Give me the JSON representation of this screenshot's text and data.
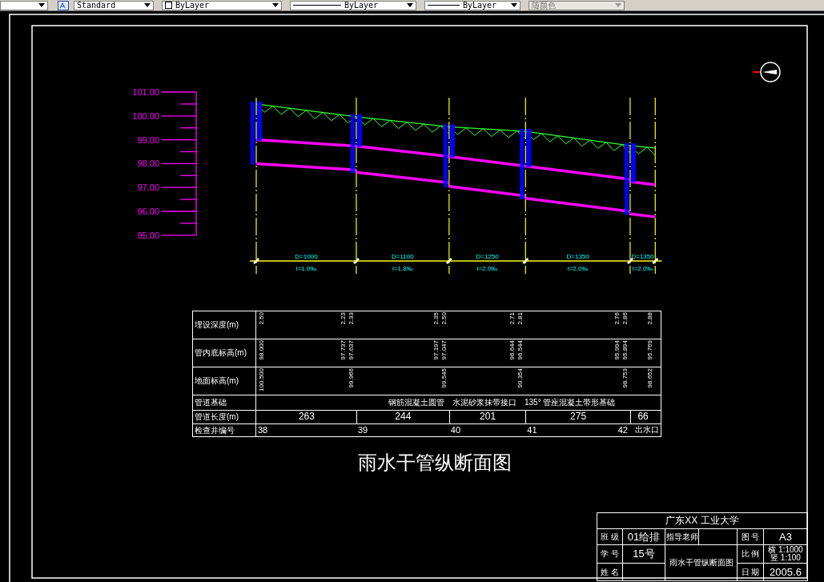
{
  "toolbar": {
    "dropdowns": [
      {
        "kind": "text-style",
        "value": "Standard",
        "disabled": false
      },
      {
        "kind": "layer-color",
        "value": "ByLayer",
        "disabled": false
      },
      {
        "kind": "linetype",
        "value": "ByLayer",
        "disabled": false
      },
      {
        "kind": "lineweight",
        "value": "ByLayer",
        "disabled": false
      },
      {
        "kind": "plot-style",
        "value": "随颜色",
        "disabled": true
      }
    ]
  },
  "profile": {
    "elevation_scale": [
      "101.00",
      "100.00",
      "99.00",
      "98.00",
      "97.00",
      "96.00",
      "95.00"
    ],
    "segments": [
      {
        "diameter": "D=1000",
        "slope": "i=1.0‰",
        "length": "263"
      },
      {
        "diameter": "D=1100",
        "slope": "i=1.8‰",
        "length": "244"
      },
      {
        "diameter": "D=1250",
        "slope": "i=2.0‰",
        "length": "201"
      },
      {
        "diameter": "D=1350",
        "slope": "i=2.0‰",
        "length": "275"
      },
      {
        "diameter": "D=1350",
        "slope": "i=2.0‰",
        "length": "66"
      }
    ],
    "stations": [
      {
        "kind": "manhole",
        "number": "38",
        "depth": [
          "2.50"
        ],
        "invert": [
          "98.000"
        ],
        "ground": "100.500"
      },
      {
        "kind": "manhole",
        "number": "39",
        "depth": [
          "2.23",
          "2.33"
        ],
        "invert": [
          "97.737",
          "97.637"
        ],
        "ground": "99.966"
      },
      {
        "kind": "manhole",
        "number": "40",
        "depth": [
          "2.35",
          "2.50"
        ],
        "invert": [
          "97.197",
          "97.047"
        ],
        "ground": "99.545"
      },
      {
        "kind": "manhole",
        "number": "41",
        "depth": [
          "2.71",
          "2.81"
        ],
        "invert": [
          "96.644",
          "96.544"
        ],
        "ground": "99.354"
      },
      {
        "kind": "manhole",
        "number": "42",
        "depth": [
          "2.76",
          "2.86"
        ],
        "invert": [
          "95.994",
          "95.894"
        ],
        "ground": "98.753"
      },
      {
        "kind": "outlet",
        "number": "出水口",
        "depth": [
          "2.88"
        ],
        "invert": [
          "95.769"
        ],
        "ground": "98.652"
      }
    ]
  },
  "table": {
    "labels": [
      "埋设深度(m)",
      "管内底标高(m)",
      "地面标高(m)",
      "管道基础",
      "管道长度(m)",
      "检查井编号"
    ],
    "foundation": [
      "钢筋混凝土圆管",
      "水泥砂浆抹带接口",
      "135° 管座混凝土带形基础"
    ]
  },
  "drawing_title": "雨水干管纵断面图",
  "title_block": {
    "school": "广东XX 工业大学",
    "class_label": "班 级",
    "class_value": "01给排",
    "advisor_label": "指导老师",
    "drawing_no_label": "图 号",
    "drawing_no": "A3",
    "student_no_label": "学 号",
    "student_no": "15号",
    "drawing_title": "雨水干管纵断面图",
    "scale_label": "比 例",
    "scale_values": [
      "横 1:1000",
      "竖 1:100"
    ],
    "name_label": "姓 名",
    "date_label": "日 期",
    "date": "2005.6"
  }
}
